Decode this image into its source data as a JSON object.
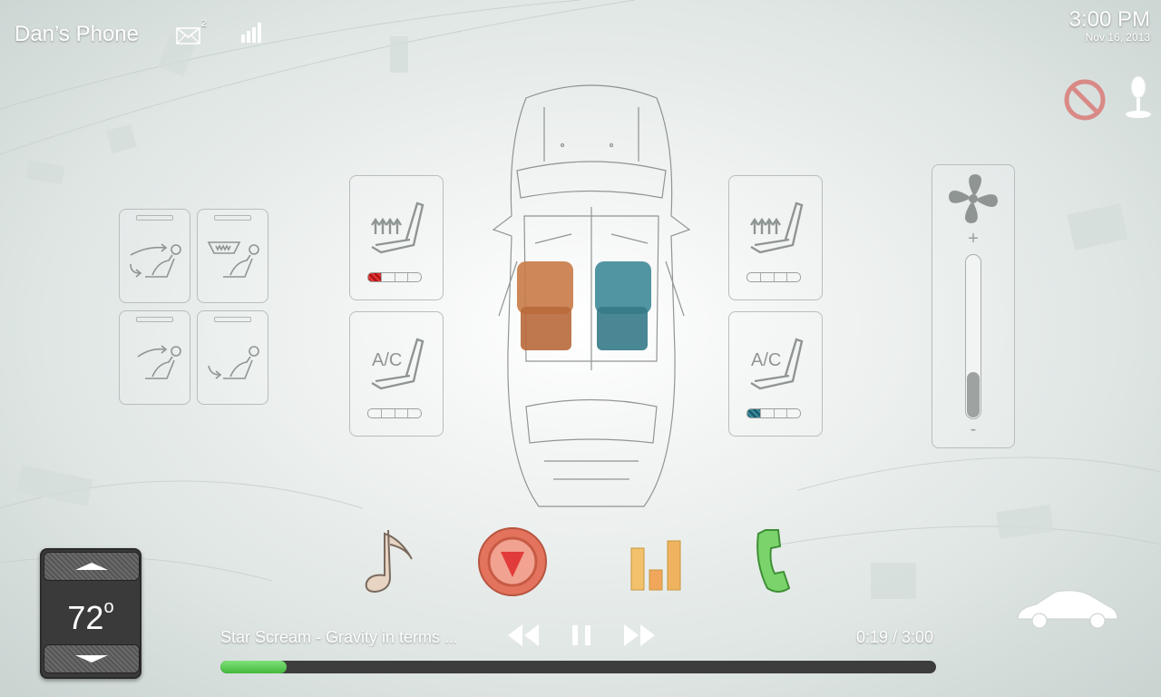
{
  "status_bar": {
    "device_name": "Dan’s Phone",
    "mail_count": "2",
    "icons": [
      "mail-icon",
      "signal-icon"
    ],
    "time": "3:00 PM",
    "date": "Nov 16, 2013"
  },
  "right_icons": [
    "no-entry-icon",
    "microphone-icon"
  ],
  "airflow_modes": [
    "airflow-face-feet-icon",
    "airflow-defrost-icon",
    "airflow-face-icon",
    "airflow-feet-icon"
  ],
  "seat_controls": {
    "driver": {
      "heat": {
        "level": 1,
        "max": 4,
        "color": "#c0171b"
      },
      "cool_label": "A/C",
      "cool": {
        "level": 0,
        "max": 4
      }
    },
    "passenger": {
      "heat": {
        "level": 0,
        "max": 4
      },
      "cool_label": "A/C",
      "cool": {
        "level": 1,
        "max": 4,
        "color": "#2b7585"
      }
    }
  },
  "car_seats": {
    "driver_color": "#c87a46",
    "passenger_color": "#3f8a98"
  },
  "fan": {
    "plus": "+",
    "minus": "-",
    "level": 0.28
  },
  "climate": {
    "temperature": "72",
    "unit": "o"
  },
  "nav_icons": [
    "music-note-icon",
    "navigation-icon",
    "equalizer-icon",
    "phone-icon"
  ],
  "media": {
    "track_title": "Star Scream - Gravity in terms ...",
    "elapsed_time": "0:19 / 3:00",
    "progress": 0.093,
    "progress_color": "#5ccb56"
  },
  "colors": {
    "accent_red": "#e06a55",
    "accent_green": "#5ccb56"
  }
}
